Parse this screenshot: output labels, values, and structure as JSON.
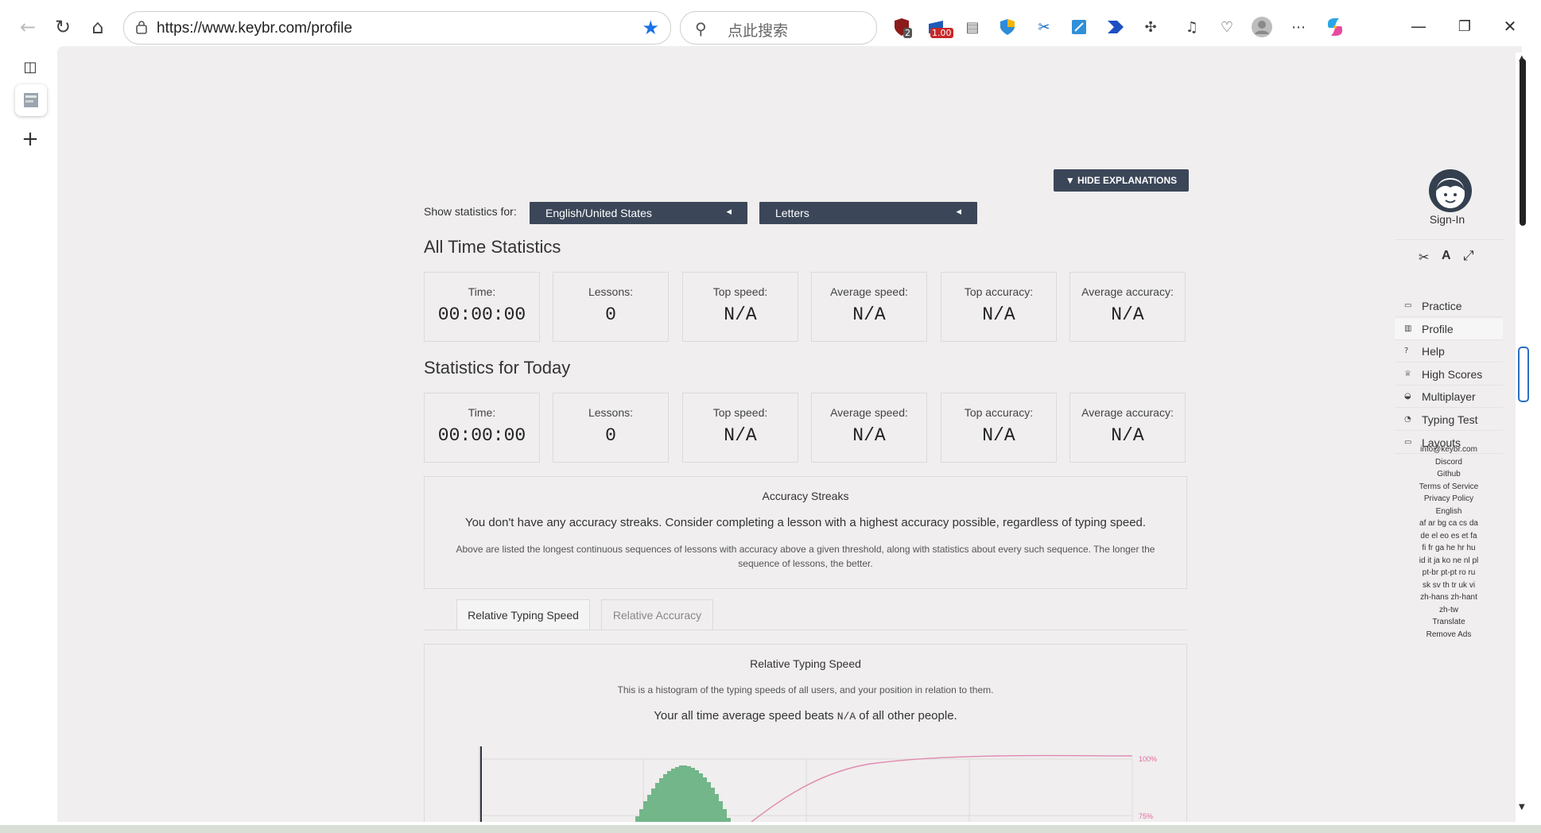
{
  "browser": {
    "url": "https://www.keybr.com/profile",
    "search_placeholder": "点此搜索",
    "ext_badges": {
      "ublock": "2",
      "price": "1.00"
    }
  },
  "page": {
    "hide_explanations": "▼ HIDE EXPLANATIONS",
    "show_stats_label": "Show statistics for:",
    "language_select": "English/United States",
    "mode_select": "Letters",
    "all_time": {
      "title": "All Time Statistics",
      "cards": [
        {
          "label": "Time:",
          "value": "00:00:00"
        },
        {
          "label": "Lessons:",
          "value": "0"
        },
        {
          "label": "Top speed:",
          "value": "N/A"
        },
        {
          "label": "Average speed:",
          "value": "N/A"
        },
        {
          "label": "Top accuracy:",
          "value": "N/A"
        },
        {
          "label": "Average accuracy:",
          "value": "N/A"
        }
      ]
    },
    "today": {
      "title": "Statistics for Today",
      "cards": [
        {
          "label": "Time:",
          "value": "00:00:00"
        },
        {
          "label": "Lessons:",
          "value": "0"
        },
        {
          "label": "Top speed:",
          "value": "N/A"
        },
        {
          "label": "Average speed:",
          "value": "N/A"
        },
        {
          "label": "Top accuracy:",
          "value": "N/A"
        },
        {
          "label": "Average accuracy:",
          "value": "N/A"
        }
      ]
    },
    "streaks": {
      "title": "Accuracy Streaks",
      "message": "You don't have any accuracy streaks. Consider completing a lesson with a highest accuracy possible, regardless of typing speed.",
      "explanation": "Above are listed the longest continuous sequences of lessons with accuracy above a given threshold, along with statistics about every such sequence. The longer the sequence of lessons, the better."
    },
    "tabs": [
      "Relative Typing Speed",
      "Relative Accuracy"
    ],
    "relative": {
      "title": "Relative Typing Speed",
      "explanation": "This is a histogram of the typing speeds of all users, and your position in relation to them.",
      "beats_prefix": "Your all time average speed beats ",
      "beats_value": "N/A",
      "beats_suffix": " of all other people.",
      "axis_labels": [
        "100%",
        "75%"
      ]
    }
  },
  "keybr_nav": {
    "signin": "Sign-In",
    "items": [
      {
        "label": "Practice",
        "icon": "keyboard-icon"
      },
      {
        "label": "Profile",
        "icon": "chart-icon"
      },
      {
        "label": "Help",
        "icon": "question-icon"
      },
      {
        "label": "High Scores",
        "icon": "trophy-icon"
      },
      {
        "label": "Multiplayer",
        "icon": "car-icon"
      },
      {
        "label": "Typing Test",
        "icon": "gauge-icon"
      },
      {
        "label": "Layouts",
        "icon": "keyboard-icon"
      }
    ],
    "footer": [
      "info@keybr.com",
      "Discord",
      "Github",
      "Terms of Service",
      "Privacy Policy",
      "English",
      "af ar bg ca cs da",
      "de el eo es et fa",
      "fi fr ga he hr hu",
      "id it ja ko ne nl pl",
      "pt-br pt-pt ro ru",
      "sk sv th tr uk vi",
      "zh-hans zh-hant",
      "zh-tw",
      "Translate",
      "Remove Ads"
    ]
  }
}
